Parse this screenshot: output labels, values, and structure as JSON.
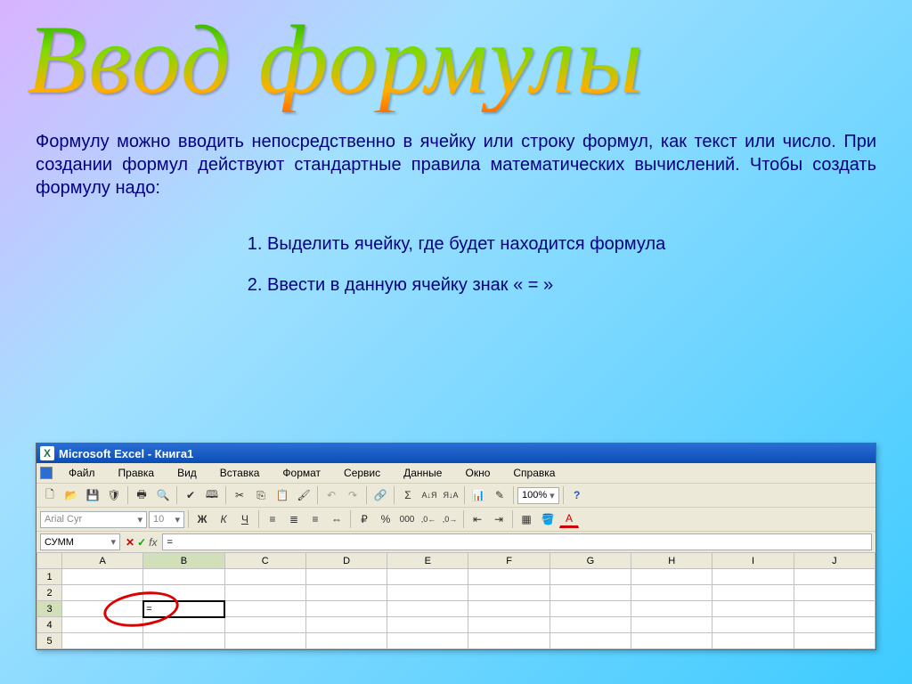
{
  "slide": {
    "title": "Ввод формулы",
    "intro": "Формулу можно вводить непосредственно в ячейку или строку формул, как текст или число. При создании формул действуют стандартные правила математических вычислений. Чтобы создать формулу надо:",
    "steps": [
      "Выделить ячейку, где будет находится формула",
      "Ввести в данную ячейку знак « = »"
    ]
  },
  "excel": {
    "titlebar": "Microsoft Excel - Книга1",
    "menu": [
      "Файл",
      "Правка",
      "Вид",
      "Вставка",
      "Формат",
      "Сервис",
      "Данные",
      "Окно",
      "Справка"
    ],
    "font_name": "Arial Cyr",
    "font_size": "10",
    "zoom": "100%",
    "name_box": "СУММ",
    "formula_bar": "=",
    "fx_label": "fx",
    "columns": [
      "A",
      "B",
      "C",
      "D",
      "E",
      "F",
      "G",
      "H",
      "I",
      "J"
    ],
    "rows": [
      "1",
      "2",
      "3",
      "4",
      "5"
    ],
    "active_col": "B",
    "active_row": "3",
    "active_cell_content": "=",
    "sigma": "Σ"
  }
}
